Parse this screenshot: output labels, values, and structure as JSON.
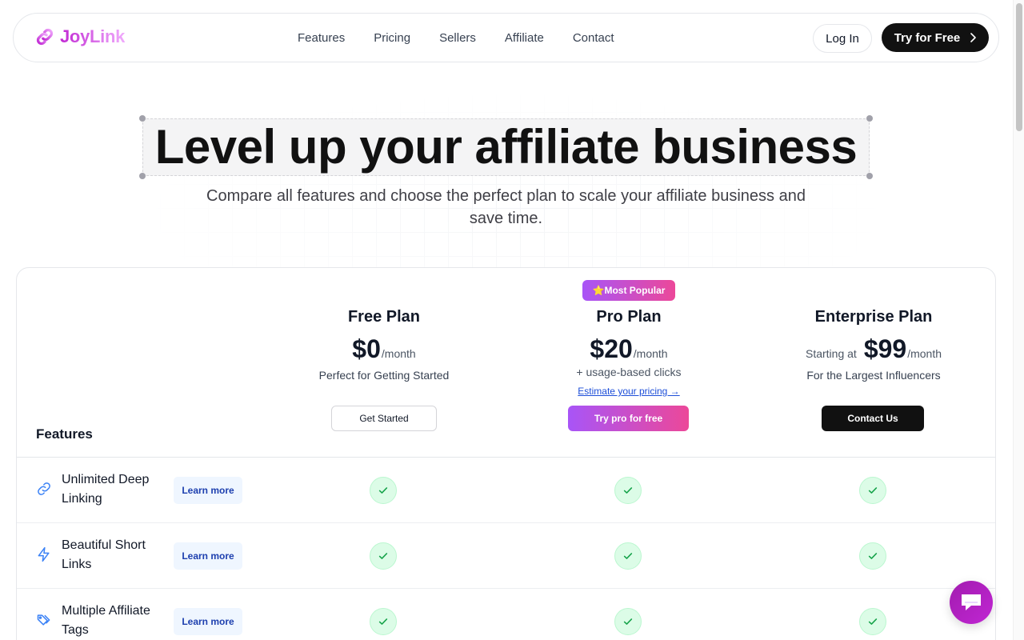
{
  "nav": {
    "logo_text": "JoyLink",
    "links": [
      "Features",
      "Pricing",
      "Sellers",
      "Affiliate",
      "Contact"
    ],
    "login_label": "Log In",
    "try_label": "Try for Free"
  },
  "hero": {
    "title": "Level up your affiliate business",
    "subtitle": "Compare all features and choose the perfect plan to scale your affiliate business and save time."
  },
  "table": {
    "features_heading": "Features",
    "badge": "⭐Most Popular",
    "plans": [
      {
        "name": "Free Plan",
        "price": "$0",
        "per": "/month",
        "desc": "Perfect for Getting Started",
        "cta": "Get Started"
      },
      {
        "name": "Pro Plan",
        "price": "$20",
        "per": "/month",
        "usage": "+ usage-based clicks",
        "estimate": "Estimate your pricing →",
        "cta": "Try pro for free"
      },
      {
        "name": "Enterprise Plan",
        "starting": "Starting at",
        "price": "$99",
        "per": "/month",
        "desc": "For the Largest Influencers",
        "cta": "Contact Us"
      }
    ],
    "learn_label": "Learn more",
    "rows": [
      {
        "label": "Unlimited Deep Linking",
        "icon": "link-icon",
        "free": true,
        "pro": true,
        "enterprise": true
      },
      {
        "label": "Beautiful Short Links",
        "icon": "lightning-icon",
        "free": true,
        "pro": true,
        "enterprise": true
      },
      {
        "label": "Multiple Affiliate Tags",
        "icon": "tags-icon",
        "free": true,
        "pro": true,
        "enterprise": true
      }
    ]
  },
  "colors": {
    "brand": "#c026d3",
    "accent_gradient_start": "#a855f7",
    "accent_gradient_end": "#ec4899",
    "check_bg": "#dcfce7",
    "check_mark": "#16a34a"
  }
}
